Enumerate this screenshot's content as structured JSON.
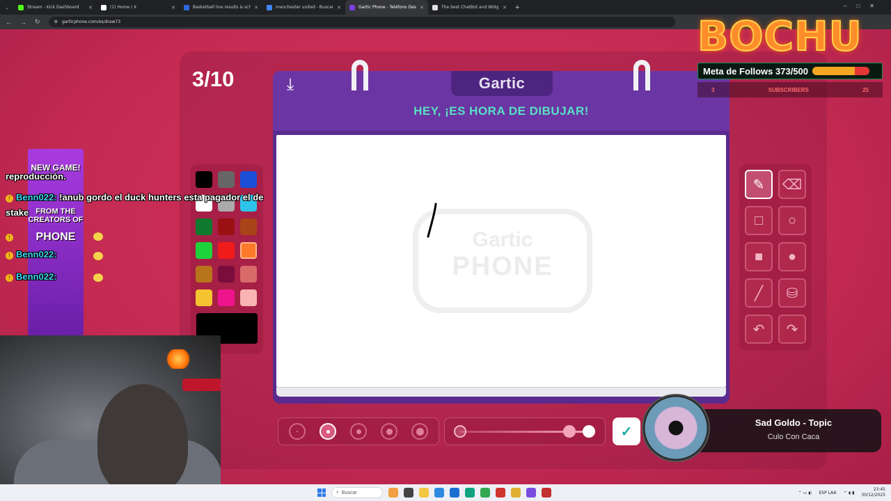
{
  "browser": {
    "tabs": [
      {
        "title": "Stream - Kick Dashboard",
        "favicon_color": "#53fc18",
        "active": false
      },
      {
        "title": "(1) Home / X",
        "favicon_color": "#ffffff",
        "active": false
      },
      {
        "title": "Basketball live results & sched",
        "favicon_color": "#2d6cdf",
        "active": false
      },
      {
        "title": "manchester united - Buscar co",
        "favicon_color": "#4285f4",
        "active": false
      },
      {
        "title": "Gartic Phone - Teléfono Desco",
        "favicon_color": "#7b3fe4",
        "active": true
      },
      {
        "title": "The best ChatBot and Widg",
        "favicon_color": "#dddddd",
        "active": false
      }
    ],
    "url": "garticphone.com/es/draw73"
  },
  "game": {
    "round_counter": "3/10",
    "logo": "Gartic",
    "heading": "HEY, ¡ES HORA DE DIBUJAR!",
    "watermark_top": "Gartic",
    "watermark_bottom": "PHONE",
    "palette": [
      "#000000",
      "#666666",
      "#1c4fd8",
      "#ffffff",
      "#aaaaaa",
      "#2ec3ea",
      "#0f7a2d",
      "#9a1013",
      "#a84417",
      "#1ed23c",
      "#f01c1c",
      "#ff7a2b",
      "#b8741a",
      "#7a0d3c",
      "#d96a6a",
      "#f4c430",
      "#f0148c",
      "#f9b3b3"
    ],
    "selected_color": "#000000",
    "tools": [
      "pencil-icon",
      "eraser-icon",
      "rect-outline-icon",
      "circle-outline-icon",
      "rect-fill-icon",
      "circle-fill-icon",
      "line-icon",
      "bucket-icon",
      "undo-icon",
      "redo-icon"
    ],
    "brush_sizes_selected_index": 1,
    "opacity_level": 0.88
  },
  "overlay": {
    "brand": "BOCHU",
    "follow_goal": "Meta de Follows 373/500",
    "follow_progress": 0.746,
    "subs_left": "3",
    "subs_label": "SUBSCRIBERS",
    "subs_right": "25",
    "chat": [
      {
        "user": "",
        "text": "reproducción."
      },
      {
        "user": "Benn022:",
        "text": "!anub gordo el duck hunters esta pagador el de"
      },
      {
        "user": "",
        "text": "stake"
      },
      {
        "user": "",
        "text": ""
      },
      {
        "user": "Benn022:",
        "text": ""
      },
      {
        "user": "Benn022:",
        "text": ""
      }
    ],
    "ad_text": "NEW GAME!",
    "ad_text2": "FROM THE CREATORS OF",
    "ad_text3": "PHONE",
    "song_title": "Sad Goldo - Topic",
    "song_artist": "Culo Con Caca"
  },
  "taskbar": {
    "search": "Buscar",
    "lang": "ESP LAA",
    "time": "23:45",
    "date": "30/12/2025"
  }
}
